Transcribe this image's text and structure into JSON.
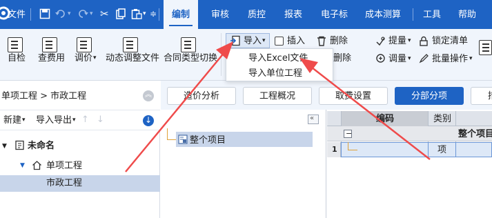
{
  "menubar": {
    "file_label": "文件",
    "tabs": [
      "编制",
      "审核",
      "质控",
      "报表",
      "电子标",
      "成本测算",
      "工具",
      "帮助"
    ],
    "active_tab": "编制"
  },
  "ribbon": {
    "self_check": "自检",
    "view_usage": "查费用",
    "adjust_price": "调价",
    "dynamic_adjust_file": "动态调整文件",
    "contract_type_switch": "合同类型切换",
    "import": "导入",
    "insert": "插入",
    "delete": "删除",
    "temp_delete_partial": "临时删除",
    "extract": "提量",
    "adjust_qty": "调量",
    "lock_list": "锁定清单",
    "batch_ops": "批量操作"
  },
  "import_menu": {
    "items": [
      "导入Excel文件",
      "导入单位工程"
    ]
  },
  "left_panel": {
    "breadcrumb": "单项工程 > 市政工程",
    "new_label": "新建",
    "import_export_label": "导入导出",
    "tree": {
      "root": "未命名",
      "child": "单项工程",
      "leaf": "市政工程"
    }
  },
  "view_tabs": [
    "造价分析",
    "工程概况",
    "取费设置",
    "分部分项",
    "措"
  ],
  "active_view_tab": "分部分项",
  "middle_tree": {
    "node": "整个项目"
  },
  "grid": {
    "headers": {
      "code": "编码",
      "category": "类别"
    },
    "group_row": {
      "toggle": "−",
      "label": "整个项目"
    },
    "rows": [
      {
        "index": "1",
        "category": "项"
      }
    ]
  },
  "colors": {
    "brand_blue": "#1e63c4",
    "ribbon_bg": "#f0f5fc",
    "selection": "#c8d5ea",
    "annotation_arrow": "#ef4b4b"
  }
}
